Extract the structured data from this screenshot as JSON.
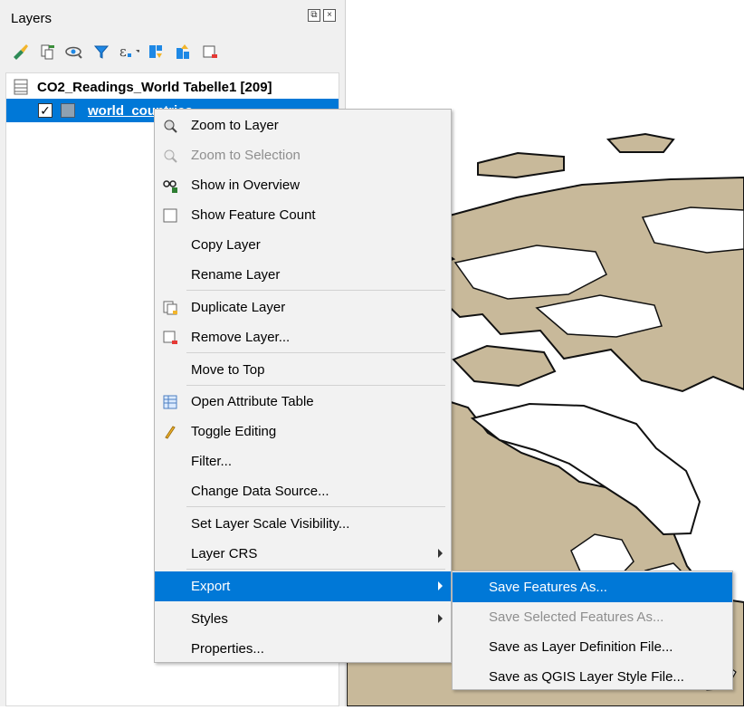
{
  "panel": {
    "title": "Layers",
    "btn_float": "⧉",
    "btn_close": "×",
    "toolbar": [
      {
        "icon": "style-brush-icon"
      },
      {
        "icon": "add-group-icon"
      },
      {
        "icon": "visibility-eye-icon"
      },
      {
        "icon": "filter-icon"
      },
      {
        "icon": "filter-expression-icon"
      },
      {
        "icon": "expand-all-icon"
      },
      {
        "icon": "collapse-all-icon"
      },
      {
        "icon": "remove-layer-icon"
      }
    ]
  },
  "tree": {
    "table_layer": "CO2_Readings_World Tabelle1 [209]",
    "world_layer": "world_countries",
    "world_checked": "✓"
  },
  "context_menu": {
    "items": [
      {
        "label": "Zoom to Layer",
        "icon": "zoom-layer-icon",
        "disabled": false
      },
      {
        "label": "Zoom to Selection",
        "icon": "zoom-selection-icon",
        "disabled": true
      },
      {
        "label": "Show in Overview",
        "icon": "overview-icon",
        "disabled": false
      },
      {
        "label": "Show Feature Count",
        "icon": "checkbox-icon",
        "disabled": false
      },
      {
        "label": "Copy Layer",
        "icon": "",
        "disabled": false
      },
      {
        "label": "Rename Layer",
        "icon": "",
        "disabled": false
      },
      {
        "label": "Duplicate Layer",
        "icon": "duplicate-layer-icon",
        "disabled": false
      },
      {
        "label": "Remove Layer...",
        "icon": "remove-layer-icon",
        "disabled": false
      },
      {
        "label": "Move to Top",
        "icon": "",
        "disabled": false
      },
      {
        "label": "Open Attribute Table",
        "icon": "attribute-table-icon",
        "disabled": false
      },
      {
        "label": "Toggle Editing",
        "icon": "pencil-icon",
        "disabled": false
      },
      {
        "label": "Filter...",
        "icon": "",
        "disabled": false
      },
      {
        "label": "Change Data Source...",
        "icon": "",
        "disabled": false
      },
      {
        "label": "Set Layer Scale Visibility...",
        "icon": "",
        "disabled": false
      },
      {
        "label": "Layer CRS",
        "icon": "",
        "disabled": false,
        "submenu": true
      },
      {
        "label": "Export",
        "icon": "",
        "disabled": false,
        "submenu": true,
        "active": true
      },
      {
        "label": "Styles",
        "icon": "",
        "disabled": false,
        "submenu": true
      },
      {
        "label": "Properties...",
        "icon": "",
        "disabled": false
      }
    ]
  },
  "export_submenu": {
    "items": [
      {
        "label": "Save Features As...",
        "active": true,
        "disabled": false
      },
      {
        "label": "Save Selected Features As...",
        "active": false,
        "disabled": true
      },
      {
        "label": "Save as Layer Definition File...",
        "active": false,
        "disabled": false
      },
      {
        "label": "Save as QGIS Layer Style File...",
        "active": false,
        "disabled": false
      }
    ]
  },
  "colors": {
    "selection": "#0078d7",
    "land": "#c8b99a",
    "land_stroke": "#111111"
  }
}
